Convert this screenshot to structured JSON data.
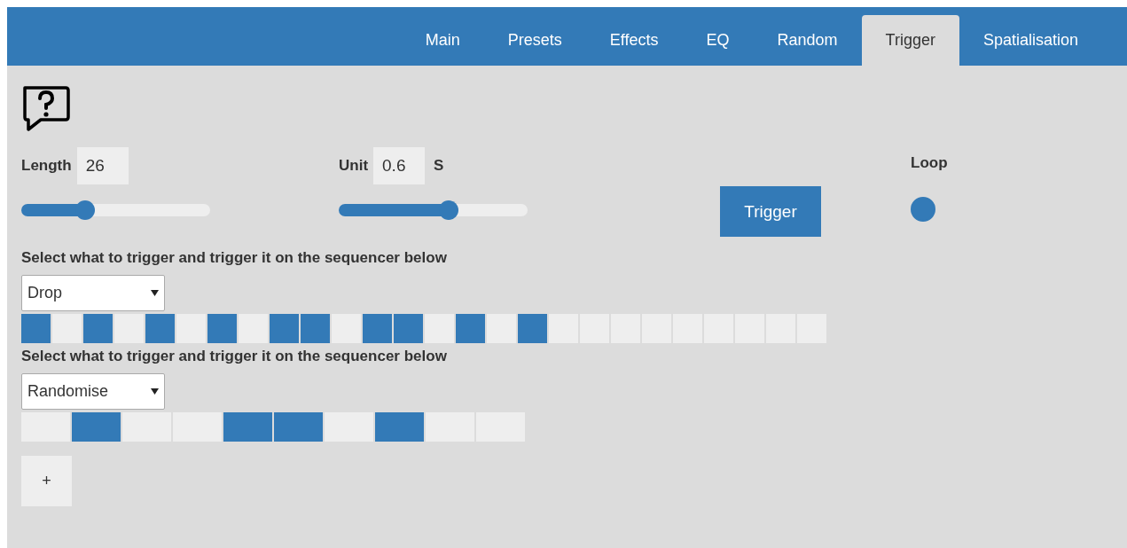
{
  "tabs": [
    {
      "label": "Main",
      "selected": false
    },
    {
      "label": "Presets",
      "selected": false
    },
    {
      "label": "Effects",
      "selected": false
    },
    {
      "label": "EQ",
      "selected": false
    },
    {
      "label": "Random",
      "selected": false
    },
    {
      "label": "Trigger",
      "selected": true
    },
    {
      "label": "Spatialisation",
      "selected": false
    }
  ],
  "length": {
    "label": "Length",
    "value": "26",
    "level": 0.34
  },
  "unit": {
    "label": "Unit",
    "value": "0.6",
    "suffix": "S",
    "level": 0.58
  },
  "trigger_button": "Trigger",
  "loop": {
    "label": "Loop",
    "on": true
  },
  "sequencers": [
    {
      "label": "Select what to trigger and trigger it on the sequencer below",
      "selection": "Drop",
      "steps": [
        true,
        false,
        true,
        false,
        true,
        false,
        true,
        false,
        true,
        true,
        false,
        true,
        true,
        false,
        true,
        false,
        true,
        false,
        false,
        false,
        false,
        false,
        false,
        false,
        false,
        false
      ]
    },
    {
      "label": "Select what to trigger and trigger it on the sequencer below",
      "selection": "Randomise",
      "steps": [
        false,
        true,
        false,
        false,
        true,
        true,
        false,
        true,
        false,
        false
      ]
    }
  ],
  "add_button": "+"
}
